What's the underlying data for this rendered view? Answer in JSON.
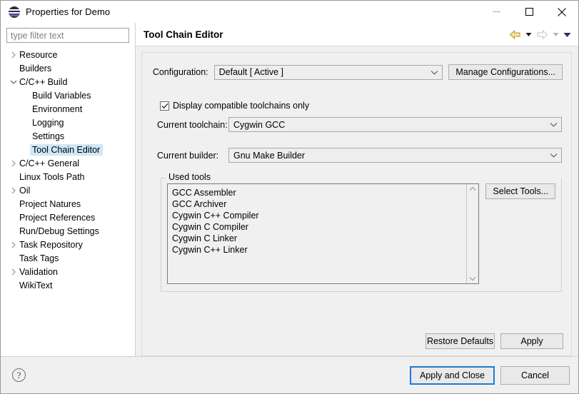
{
  "window": {
    "title": "Properties for Demo",
    "icon": "eclipse-icon",
    "controls": {
      "minimize": "minimize-icon",
      "maximize": "maximize-icon",
      "close": "close-icon"
    }
  },
  "sidebar": {
    "filter": {
      "placeholder": "type filter text",
      "value": ""
    },
    "items": [
      {
        "label": "Resource",
        "level": 1,
        "expandable": true,
        "expanded": false,
        "selected": false
      },
      {
        "label": "Builders",
        "level": 1,
        "expandable": false,
        "expanded": false,
        "selected": false
      },
      {
        "label": "C/C++ Build",
        "level": 1,
        "expandable": true,
        "expanded": true,
        "selected": false
      },
      {
        "label": "Build Variables",
        "level": 2,
        "expandable": false,
        "expanded": false,
        "selected": false
      },
      {
        "label": "Environment",
        "level": 2,
        "expandable": false,
        "expanded": false,
        "selected": false
      },
      {
        "label": "Logging",
        "level": 2,
        "expandable": false,
        "expanded": false,
        "selected": false
      },
      {
        "label": "Settings",
        "level": 2,
        "expandable": false,
        "expanded": false,
        "selected": false
      },
      {
        "label": "Tool Chain Editor",
        "level": 2,
        "expandable": false,
        "expanded": false,
        "selected": true
      },
      {
        "label": "C/C++ General",
        "level": 1,
        "expandable": true,
        "expanded": false,
        "selected": false
      },
      {
        "label": "Linux Tools Path",
        "level": 1,
        "expandable": false,
        "expanded": false,
        "selected": false
      },
      {
        "label": "Oil",
        "level": 1,
        "expandable": true,
        "expanded": false,
        "selected": false
      },
      {
        "label": "Project Natures",
        "level": 1,
        "expandable": false,
        "expanded": false,
        "selected": false
      },
      {
        "label": "Project References",
        "level": 1,
        "expandable": false,
        "expanded": false,
        "selected": false
      },
      {
        "label": "Run/Debug Settings",
        "level": 1,
        "expandable": false,
        "expanded": false,
        "selected": false
      },
      {
        "label": "Task Repository",
        "level": 1,
        "expandable": true,
        "expanded": false,
        "selected": false
      },
      {
        "label": "Task Tags",
        "level": 1,
        "expandable": false,
        "expanded": false,
        "selected": false
      },
      {
        "label": "Validation",
        "level": 1,
        "expandable": true,
        "expanded": false,
        "selected": false
      },
      {
        "label": "WikiText",
        "level": 1,
        "expandable": false,
        "expanded": false,
        "selected": false
      }
    ]
  },
  "main": {
    "page_title": "Tool Chain Editor",
    "nav": {
      "back_icon": "back-arrow-icon",
      "back_menu_icon": "chevron-down-icon",
      "forward_icon": "forward-arrow-icon",
      "forward_menu_icon": "chevron-down-icon",
      "view_menu_icon": "chevron-down-icon"
    },
    "configuration": {
      "label": "Configuration:",
      "selected": "Default  [ Active ]",
      "manage_button": "Manage Configurations..."
    },
    "display_compatible": {
      "label": "Display compatible toolchains only",
      "checked": true
    },
    "current_toolchain": {
      "label": "Current toolchain:",
      "selected": "Cygwin GCC"
    },
    "current_builder": {
      "label": "Current builder:",
      "selected": "Gnu Make Builder"
    },
    "used_tools": {
      "legend": "Used tools",
      "items": [
        "GCC Assembler",
        "GCC Archiver",
        "Cygwin C++ Compiler",
        "Cygwin C Compiler",
        "Cygwin C Linker",
        "Cygwin C++ Linker"
      ],
      "select_button": "Select Tools..."
    },
    "restore_defaults_button": "Restore Defaults",
    "apply_button": "Apply"
  },
  "footer": {
    "help_icon": "help-icon",
    "help_glyph": "?",
    "apply_and_close_button": "Apply and Close",
    "cancel_button": "Cancel"
  },
  "colors": {
    "selection": "#cde8f6",
    "primary_border": "#1c7cd6",
    "back_arrow": "#e8c84a",
    "forward_arrow": "#cccccc",
    "view_menu": "#3b2a5a",
    "dialog_bg": "#f0f0f0"
  }
}
